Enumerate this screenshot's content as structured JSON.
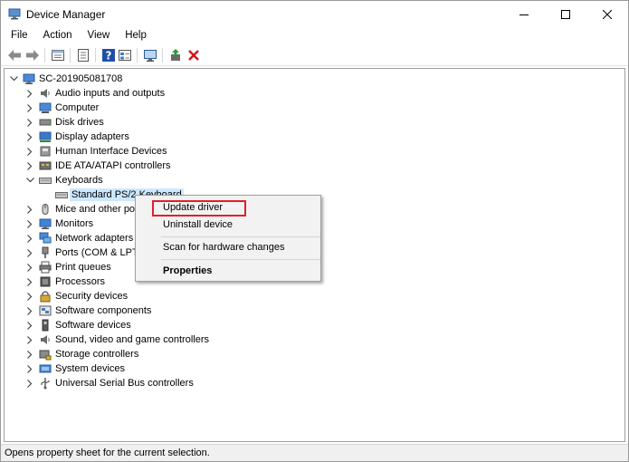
{
  "window": {
    "title": "Device Manager"
  },
  "menu": [
    "File",
    "Action",
    "View",
    "Help"
  ],
  "toolbar": {
    "buttons": [
      "back-arrow-icon",
      "forward-arrow-icon",
      "properties-sheet-icon",
      "help-book-icon",
      "help-icon",
      "details-view-icon",
      "scan-monitor-icon",
      "update-driver-icon",
      "uninstall-x-icon"
    ]
  },
  "tree": {
    "root": "SC-201905081708",
    "items": [
      {
        "label": "Audio inputs and outputs",
        "icon": "speaker-icon"
      },
      {
        "label": "Computer",
        "icon": "computer-icon"
      },
      {
        "label": "Disk drives",
        "icon": "disk-drive-icon"
      },
      {
        "label": "Display adapters",
        "icon": "display-adapter-icon"
      },
      {
        "label": "Human Interface Devices",
        "icon": "hid-icon"
      },
      {
        "label": "IDE ATA/ATAPI controllers",
        "icon": "ide-controller-icon"
      },
      {
        "label": "Keyboards",
        "icon": "keyboard-icon",
        "expanded": true,
        "children": [
          {
            "label": "Standard PS/2 Keyboard",
            "icon": "keyboard-icon",
            "selected": true
          }
        ]
      },
      {
        "label": "Mice and other poi",
        "icon": "mouse-icon"
      },
      {
        "label": "Monitors",
        "icon": "monitor-icon"
      },
      {
        "label": "Network adapters",
        "icon": "network-adapter-icon"
      },
      {
        "label": "Ports (COM & LPT)",
        "icon": "port-icon"
      },
      {
        "label": "Print queues",
        "icon": "printer-icon"
      },
      {
        "label": "Processors",
        "icon": "processor-icon"
      },
      {
        "label": "Security devices",
        "icon": "security-device-icon"
      },
      {
        "label": "Software components",
        "icon": "software-component-icon"
      },
      {
        "label": "Software devices",
        "icon": "software-device-icon"
      },
      {
        "label": "Sound, video and game controllers",
        "icon": "sound-icon"
      },
      {
        "label": "Storage controllers",
        "icon": "storage-controller-icon"
      },
      {
        "label": "System devices",
        "icon": "system-device-icon"
      },
      {
        "label": "Universal Serial Bus controllers",
        "icon": "usb-icon"
      }
    ]
  },
  "context_menu": {
    "items": [
      {
        "label": "Update driver",
        "highlighted": true
      },
      {
        "label": "Uninstall device"
      },
      {
        "label": "Scan for hardware changes"
      },
      {
        "label": "Properties",
        "bold": true
      }
    ]
  },
  "status": {
    "text": "Opens property sheet for the current selection."
  }
}
